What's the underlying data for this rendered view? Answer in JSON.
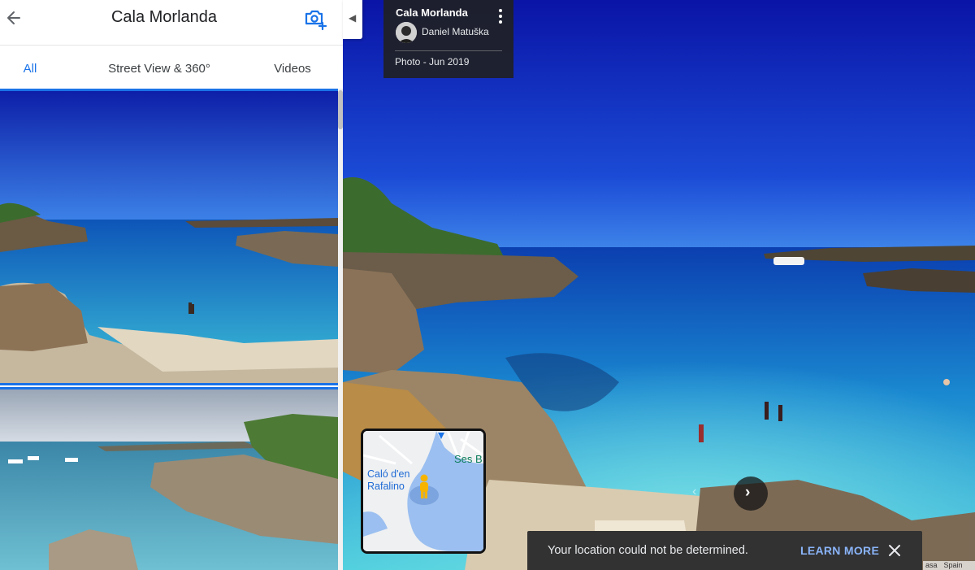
{
  "header": {
    "title": "Cala Morlanda",
    "back_icon": "arrow-left-icon",
    "add_photo_icon": "add-photo-camera-icon"
  },
  "tabs": [
    {
      "label": "All",
      "active": true
    },
    {
      "label": "Street View & 360°",
      "active": false
    },
    {
      "label": "Videos",
      "active": false
    }
  ],
  "info_card": {
    "title": "Cala Morlanda",
    "author": "Daniel Matuška",
    "date": "Photo - Jun 2019",
    "menu_icon": "more-vert-icon"
  },
  "mini_map": {
    "label_1": "Caló d'en Rafalino",
    "label_2": "Ses B"
  },
  "snackbar": {
    "message": "Your location could not be determined.",
    "action": "LEARN MORE",
    "close_icon": "close-icon"
  },
  "map_credit": {
    "left": "asa",
    "right": "Spain"
  },
  "colors": {
    "accent": "#1a73e8",
    "snack_action": "#8ab4f8",
    "card_bg": "#202124"
  }
}
